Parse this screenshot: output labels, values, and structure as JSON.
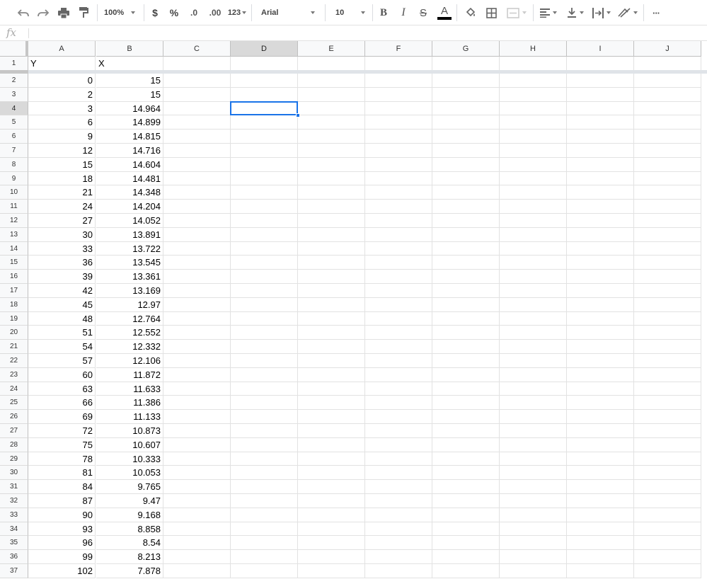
{
  "toolbar": {
    "zoom": "100%",
    "currency": "$",
    "percent": "%",
    "decrease_decimals": ".0",
    "increase_decimals": ".00",
    "more_formats": "123",
    "font": "Arial",
    "font_size": "10",
    "bold": "B",
    "italic": "I",
    "strikethrough": "S",
    "text_color": "A",
    "more": "···",
    "icons": [
      "undo-icon",
      "redo-icon",
      "print-icon",
      "paint-format-icon",
      "fill-color-icon",
      "borders-icon",
      "merge-cells-icon",
      "horizontal-align-icon",
      "vertical-align-icon",
      "text-wrap-icon",
      "text-rotation-icon",
      "more-icon"
    ]
  },
  "formula_bar": {
    "fx": "fx",
    "value": ""
  },
  "columns": [
    "A",
    "B",
    "C",
    "D",
    "E",
    "F",
    "G",
    "H",
    "I",
    "J"
  ],
  "selected_cell": "D4",
  "header_row": {
    "row": "1",
    "cells": [
      "Y",
      "X",
      "",
      "",
      "",
      "",
      "",
      "",
      "",
      ""
    ]
  },
  "rows": [
    {
      "row": "2",
      "a": "0",
      "b": "15"
    },
    {
      "row": "3",
      "a": "2",
      "b": "15"
    },
    {
      "row": "4",
      "a": "3",
      "b": "14.964"
    },
    {
      "row": "5",
      "a": "6",
      "b": "14.899"
    },
    {
      "row": "6",
      "a": "9",
      "b": "14.815"
    },
    {
      "row": "7",
      "a": "12",
      "b": "14.716"
    },
    {
      "row": "8",
      "a": "15",
      "b": "14.604"
    },
    {
      "row": "9",
      "a": "18",
      "b": "14.481"
    },
    {
      "row": "10",
      "a": "21",
      "b": "14.348"
    },
    {
      "row": "11",
      "a": "24",
      "b": "14.204"
    },
    {
      "row": "12",
      "a": "27",
      "b": "14.052"
    },
    {
      "row": "13",
      "a": "30",
      "b": "13.891"
    },
    {
      "row": "14",
      "a": "33",
      "b": "13.722"
    },
    {
      "row": "15",
      "a": "36",
      "b": "13.545"
    },
    {
      "row": "16",
      "a": "39",
      "b": "13.361"
    },
    {
      "row": "17",
      "a": "42",
      "b": "13.169"
    },
    {
      "row": "18",
      "a": "45",
      "b": "12.97"
    },
    {
      "row": "19",
      "a": "48",
      "b": "12.764"
    },
    {
      "row": "20",
      "a": "51",
      "b": "12.552"
    },
    {
      "row": "21",
      "a": "54",
      "b": "12.332"
    },
    {
      "row": "22",
      "a": "57",
      "b": "12.106"
    },
    {
      "row": "23",
      "a": "60",
      "b": "11.872"
    },
    {
      "row": "24",
      "a": "63",
      "b": "11.633"
    },
    {
      "row": "25",
      "a": "66",
      "b": "11.386"
    },
    {
      "row": "26",
      "a": "69",
      "b": "11.133"
    },
    {
      "row": "27",
      "a": "72",
      "b": "10.873"
    },
    {
      "row": "28",
      "a": "75",
      "b": "10.607"
    },
    {
      "row": "29",
      "a": "78",
      "b": "10.333"
    },
    {
      "row": "30",
      "a": "81",
      "b": "10.053"
    },
    {
      "row": "31",
      "a": "84",
      "b": "9.765"
    },
    {
      "row": "32",
      "a": "87",
      "b": "9.47"
    },
    {
      "row": "33",
      "a": "90",
      "b": "9.168"
    },
    {
      "row": "34",
      "a": "93",
      "b": "8.858"
    },
    {
      "row": "35",
      "a": "96",
      "b": "8.54"
    },
    {
      "row": "36",
      "a": "99",
      "b": "8.213"
    },
    {
      "row": "37",
      "a": "102",
      "b": "7.878"
    }
  ],
  "colors": {
    "selection": "#1a73e8",
    "header_bg": "#f8f9fa",
    "header_selected": "#d9d9d9",
    "gridline": "#e2e2e2"
  }
}
